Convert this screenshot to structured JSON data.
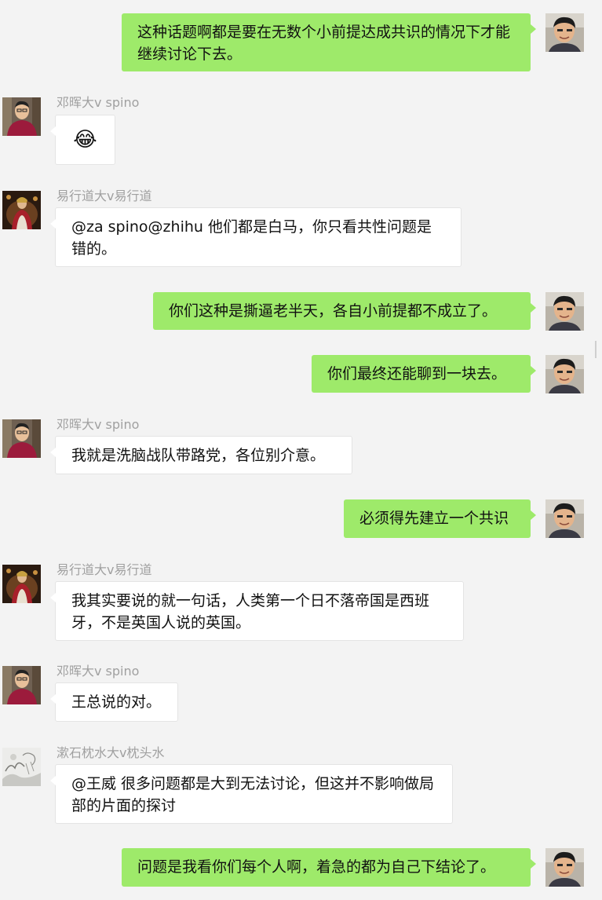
{
  "participants": {
    "me": {
      "avatar_icon": "self-avatar-photo"
    },
    "deng": {
      "name": "邓晖大v spino",
      "avatar_icon": "red-shirt-man-avatar"
    },
    "yi": {
      "name": "易行道大v易行道",
      "avatar_icon": "napoleon-painting-avatar"
    },
    "shu": {
      "name": "漱石枕水大v枕头水",
      "avatar_icon": "ink-landscape-avatar"
    }
  },
  "messages": [
    {
      "side": "right",
      "text": "这种话题啊都是要在无数个小前提达成共识的情况下才能继续讨论下去。"
    },
    {
      "side": "left",
      "sender": "邓晖大v spino",
      "text": "😂"
    },
    {
      "side": "left",
      "sender": "易行道大v易行道",
      "text": "@za spino@zhihu 他们都是白马，你只看共性问题是错的。"
    },
    {
      "side": "right",
      "text": "你们这种是撕逼老半天，各自小前提都不成立了。"
    },
    {
      "side": "right",
      "text": "你们最终还能聊到一块去。"
    },
    {
      "side": "left",
      "sender": "邓晖大v spino",
      "text": "我就是洗脑战队带路党，各位别介意。"
    },
    {
      "side": "right",
      "text": "必须得先建立一个共识"
    },
    {
      "side": "left",
      "sender": "易行道大v易行道",
      "text": "我其实要说的就一句话，人类第一个日不落帝国是西班牙，不是英国人说的英国。"
    },
    {
      "side": "left",
      "sender": "邓晖大v spino",
      "text": "王总说的对。"
    },
    {
      "side": "left",
      "sender": "漱石枕水大v枕头水",
      "text": "@王威 很多问题都是大到无法讨论，但这并不影响做局部的片面的探讨"
    },
    {
      "side": "right",
      "text": "问题是我看你们每个人啊，着急的都为自己下结论了。"
    }
  ],
  "colors": {
    "background": "#f3f3f3",
    "self_bubble": "#9eea6a",
    "other_bubble": "#ffffff",
    "sender_name": "#a0a0a0"
  }
}
